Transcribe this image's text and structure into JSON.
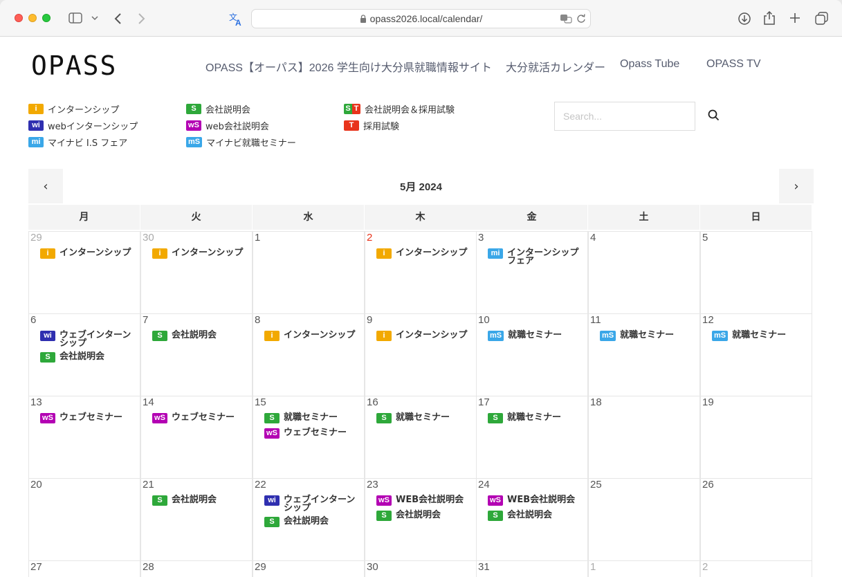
{
  "browser": {
    "url": "opass2026.local/calendar/"
  },
  "header": {
    "logo_text": "OPASS",
    "nav": [
      "OPASS【オーパス】2026 学生向け大分県就職情報サイト",
      "大分就活カレンダー",
      "Opass Tube",
      "OPASS TV"
    ]
  },
  "legend": [
    {
      "badge": "i",
      "type": "i",
      "label": "インターンシップ"
    },
    {
      "badge": "wi",
      "type": "wi",
      "label": "webインターンシップ"
    },
    {
      "badge": "mi",
      "type": "mi",
      "label": "マイナビ I.S フェア"
    },
    {
      "badge": "S",
      "type": "s",
      "label": "会社説明会"
    },
    {
      "badge": "wS",
      "type": "ws",
      "label": "web会社説明会"
    },
    {
      "badge": "mS",
      "type": "ms",
      "label": "マイナビ就職セミナー"
    },
    {
      "badge": "ST",
      "type": "st",
      "label": "会社説明会＆採用試験"
    },
    {
      "badge": "T",
      "type": "t",
      "label": "採用試験"
    }
  ],
  "search": {
    "placeholder": "Search..."
  },
  "calendar": {
    "title": "5月 2024",
    "prev": "‹",
    "next": "›",
    "weekdays": [
      "月",
      "火",
      "水",
      "木",
      "金",
      "土",
      "日"
    ],
    "weeks": [
      [
        {
          "day": "29",
          "other": true,
          "events": [
            {
              "type": "i",
              "badge": "i",
              "label": "インターンシップ"
            }
          ]
        },
        {
          "day": "30",
          "other": true,
          "events": [
            {
              "type": "i",
              "badge": "i",
              "label": "インターンシップ"
            }
          ]
        },
        {
          "day": "1",
          "events": []
        },
        {
          "day": "2",
          "red": true,
          "events": [
            {
              "type": "i",
              "badge": "i",
              "label": "インターンシップ"
            }
          ]
        },
        {
          "day": "3",
          "events": [
            {
              "type": "mi",
              "badge": "mi",
              "label": "インターンシップフェア"
            }
          ]
        },
        {
          "day": "4",
          "events": []
        },
        {
          "day": "5",
          "events": []
        }
      ],
      [
        {
          "day": "6",
          "events": [
            {
              "type": "wi",
              "badge": "wi",
              "label": "ウェブインターンシップ"
            },
            {
              "type": "s",
              "badge": "S",
              "label": "会社説明会"
            }
          ]
        },
        {
          "day": "7",
          "events": [
            {
              "type": "s",
              "badge": "S",
              "label": "会社説明会"
            }
          ]
        },
        {
          "day": "8",
          "events": [
            {
              "type": "i",
              "badge": "i",
              "label": "インターンシップ"
            }
          ]
        },
        {
          "day": "9",
          "events": [
            {
              "type": "i",
              "badge": "i",
              "label": "インターンシップ"
            }
          ]
        },
        {
          "day": "10",
          "events": [
            {
              "type": "ms",
              "badge": "mS",
              "label": "就職セミナー"
            }
          ]
        },
        {
          "day": "11",
          "events": [
            {
              "type": "ms",
              "badge": "mS",
              "label": "就職セミナー"
            }
          ]
        },
        {
          "day": "12",
          "events": [
            {
              "type": "ms",
              "badge": "mS",
              "label": "就職セミナー"
            }
          ]
        }
      ],
      [
        {
          "day": "13",
          "events": [
            {
              "type": "ws",
              "badge": "wS",
              "label": "ウェブセミナー"
            }
          ]
        },
        {
          "day": "14",
          "events": [
            {
              "type": "ws",
              "badge": "wS",
              "label": "ウェブセミナー"
            }
          ]
        },
        {
          "day": "15",
          "events": [
            {
              "type": "s",
              "badge": "S",
              "label": "就職セミナー"
            },
            {
              "type": "ws",
              "badge": "wS",
              "label": "ウェブセミナー"
            }
          ]
        },
        {
          "day": "16",
          "events": [
            {
              "type": "s",
              "badge": "S",
              "label": "就職セミナー"
            }
          ]
        },
        {
          "day": "17",
          "events": [
            {
              "type": "s",
              "badge": "S",
              "label": "就職セミナー"
            }
          ]
        },
        {
          "day": "18",
          "events": []
        },
        {
          "day": "19",
          "events": []
        }
      ],
      [
        {
          "day": "20",
          "events": []
        },
        {
          "day": "21",
          "events": [
            {
              "type": "s",
              "badge": "S",
              "label": "会社説明会"
            }
          ]
        },
        {
          "day": "22",
          "events": [
            {
              "type": "wi",
              "badge": "wi",
              "label": "ウェブインターンシップ"
            },
            {
              "type": "s",
              "badge": "S",
              "label": "会社説明会"
            }
          ]
        },
        {
          "day": "23",
          "events": [
            {
              "type": "ws",
              "badge": "wS",
              "label": "WEB会社説明会"
            },
            {
              "type": "s",
              "badge": "S",
              "label": "会社説明会"
            }
          ]
        },
        {
          "day": "24",
          "events": [
            {
              "type": "ws",
              "badge": "wS",
              "label": "WEB会社説明会"
            },
            {
              "type": "s",
              "badge": "S",
              "label": "会社説明会"
            }
          ]
        },
        {
          "day": "25",
          "events": []
        },
        {
          "day": "26",
          "events": []
        }
      ],
      [
        {
          "day": "27",
          "events": []
        },
        {
          "day": "28",
          "events": []
        },
        {
          "day": "29",
          "events": []
        },
        {
          "day": "30",
          "events": []
        },
        {
          "day": "31",
          "events": []
        },
        {
          "day": "1",
          "other": true,
          "events": []
        },
        {
          "day": "2",
          "other": true,
          "events": []
        }
      ]
    ]
  },
  "colors": {
    "i": "#f2a900",
    "wi": "#2f2fb0",
    "mi": "#3aa7e8",
    "s": "#2ea83a",
    "ws": "#b300b3",
    "ms": "#3aa7e8",
    "t": "#e8341c"
  }
}
